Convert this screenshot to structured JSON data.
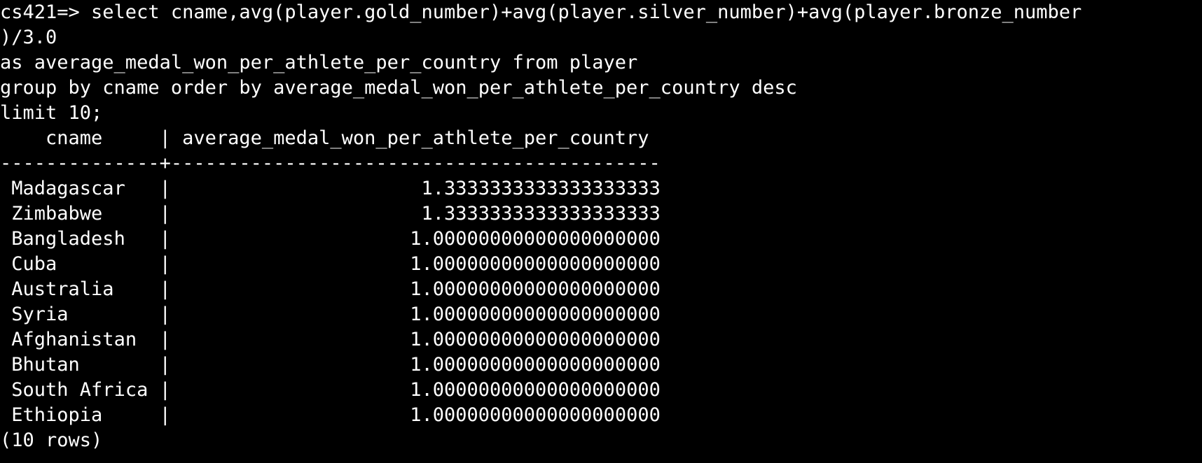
{
  "terminal": {
    "background": "#000000",
    "foreground": "#ffffff",
    "query_lines": [
      "cs421=> select cname,avg(player.gold_number)+avg(player.silver_number)+avg(player.bronze_number",
      ")/3.0",
      "as average_medal_won_per_athlete_per_country from player",
      "group by cname order by average_medal_won_per_athlete_per_country desc",
      "limit 10;"
    ],
    "result": {
      "header_line": "    cname     | average_medal_won_per_athlete_per_country",
      "divider_line": "--------------+-------------------------------------------",
      "columns": [
        "cname",
        "average_medal_won_per_athlete_per_country"
      ],
      "rows": [
        {
          "cname": "Madagascar",
          "value": "1.3333333333333333333"
        },
        {
          "cname": "Zimbabwe",
          "value": "1.3333333333333333333"
        },
        {
          "cname": "Bangladesh",
          "value": "1.00000000000000000000"
        },
        {
          "cname": "Cuba",
          "value": "1.00000000000000000000"
        },
        {
          "cname": "Australia",
          "value": "1.00000000000000000000"
        },
        {
          "cname": "Syria",
          "value": "1.00000000000000000000"
        },
        {
          "cname": "Afghanistan",
          "value": "1.00000000000000000000"
        },
        {
          "cname": "Bhutan",
          "value": "1.00000000000000000000"
        },
        {
          "cname": "South Africa",
          "value": "1.00000000000000000000"
        },
        {
          "cname": "Ethiopia",
          "value": "1.00000000000000000000"
        }
      ],
      "footer": "(10 rows)"
    }
  }
}
